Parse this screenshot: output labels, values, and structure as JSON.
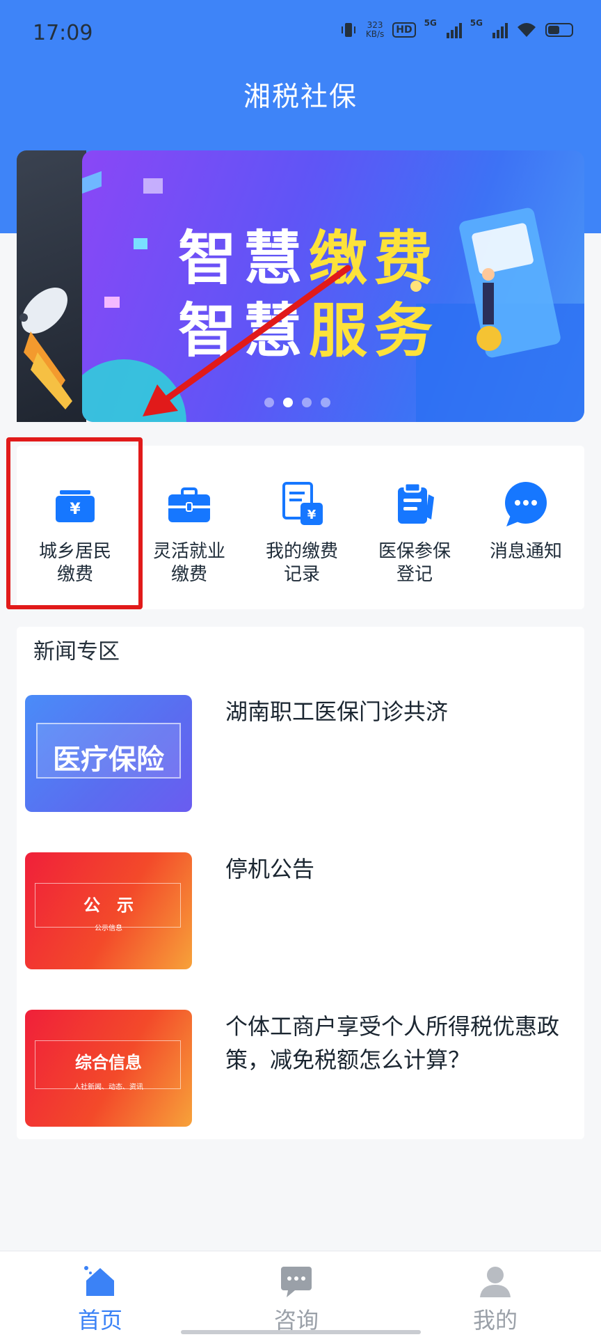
{
  "status_bar": {
    "time": "17:09",
    "speed_value": "323",
    "speed_unit": "KB/s",
    "hd_label": "HD",
    "signal_1": "5G",
    "signal_2": "5G"
  },
  "header": {
    "title": "湘税社保"
  },
  "banner": {
    "line1_prefix": "智慧",
    "line1_highlight": "缴费",
    "line2_prefix": "智慧",
    "line2_highlight": "服务",
    "page_count": 4,
    "active_page": 2
  },
  "menu": {
    "items": [
      {
        "line1": "城乡居民",
        "line2": "缴费",
        "icon": "wallet-yen-icon"
      },
      {
        "line1": "灵活就业",
        "line2": "缴费",
        "icon": "briefcase-icon"
      },
      {
        "line1": "我的缴费",
        "line2": "记录",
        "icon": "document-yen-icon"
      },
      {
        "line1": "医保参保",
        "line2": "登记",
        "icon": "clipboard-icon"
      },
      {
        "line1": "消息通知",
        "line2": "",
        "icon": "chat-bubble-icon"
      }
    ]
  },
  "news": {
    "heading": "新闻专区",
    "items": [
      {
        "title": "湖南职工医保门诊共济",
        "thumb_text": "医疗保险",
        "thumb_sub": ""
      },
      {
        "title": "停机公告",
        "thumb_text": "公　示",
        "thumb_sub": "公示信息"
      },
      {
        "title": "个体工商户享受个人所得税优惠政策，减免税额怎么计算？",
        "thumb_text": "综合信息",
        "thumb_sub": "人社新闻、动态、资讯"
      }
    ]
  },
  "bottom_nav": {
    "items": [
      {
        "label": "首页",
        "icon": "home-icon",
        "active": true
      },
      {
        "label": "咨询",
        "icon": "consult-icon",
        "active": false
      },
      {
        "label": "我的",
        "icon": "user-icon",
        "active": false
      }
    ]
  },
  "colors": {
    "header_blue": "#3e84f8",
    "menu_icon_blue": "#1677ff",
    "annotation_red": "#e11a1a",
    "banner_highlight": "#fde23a"
  }
}
